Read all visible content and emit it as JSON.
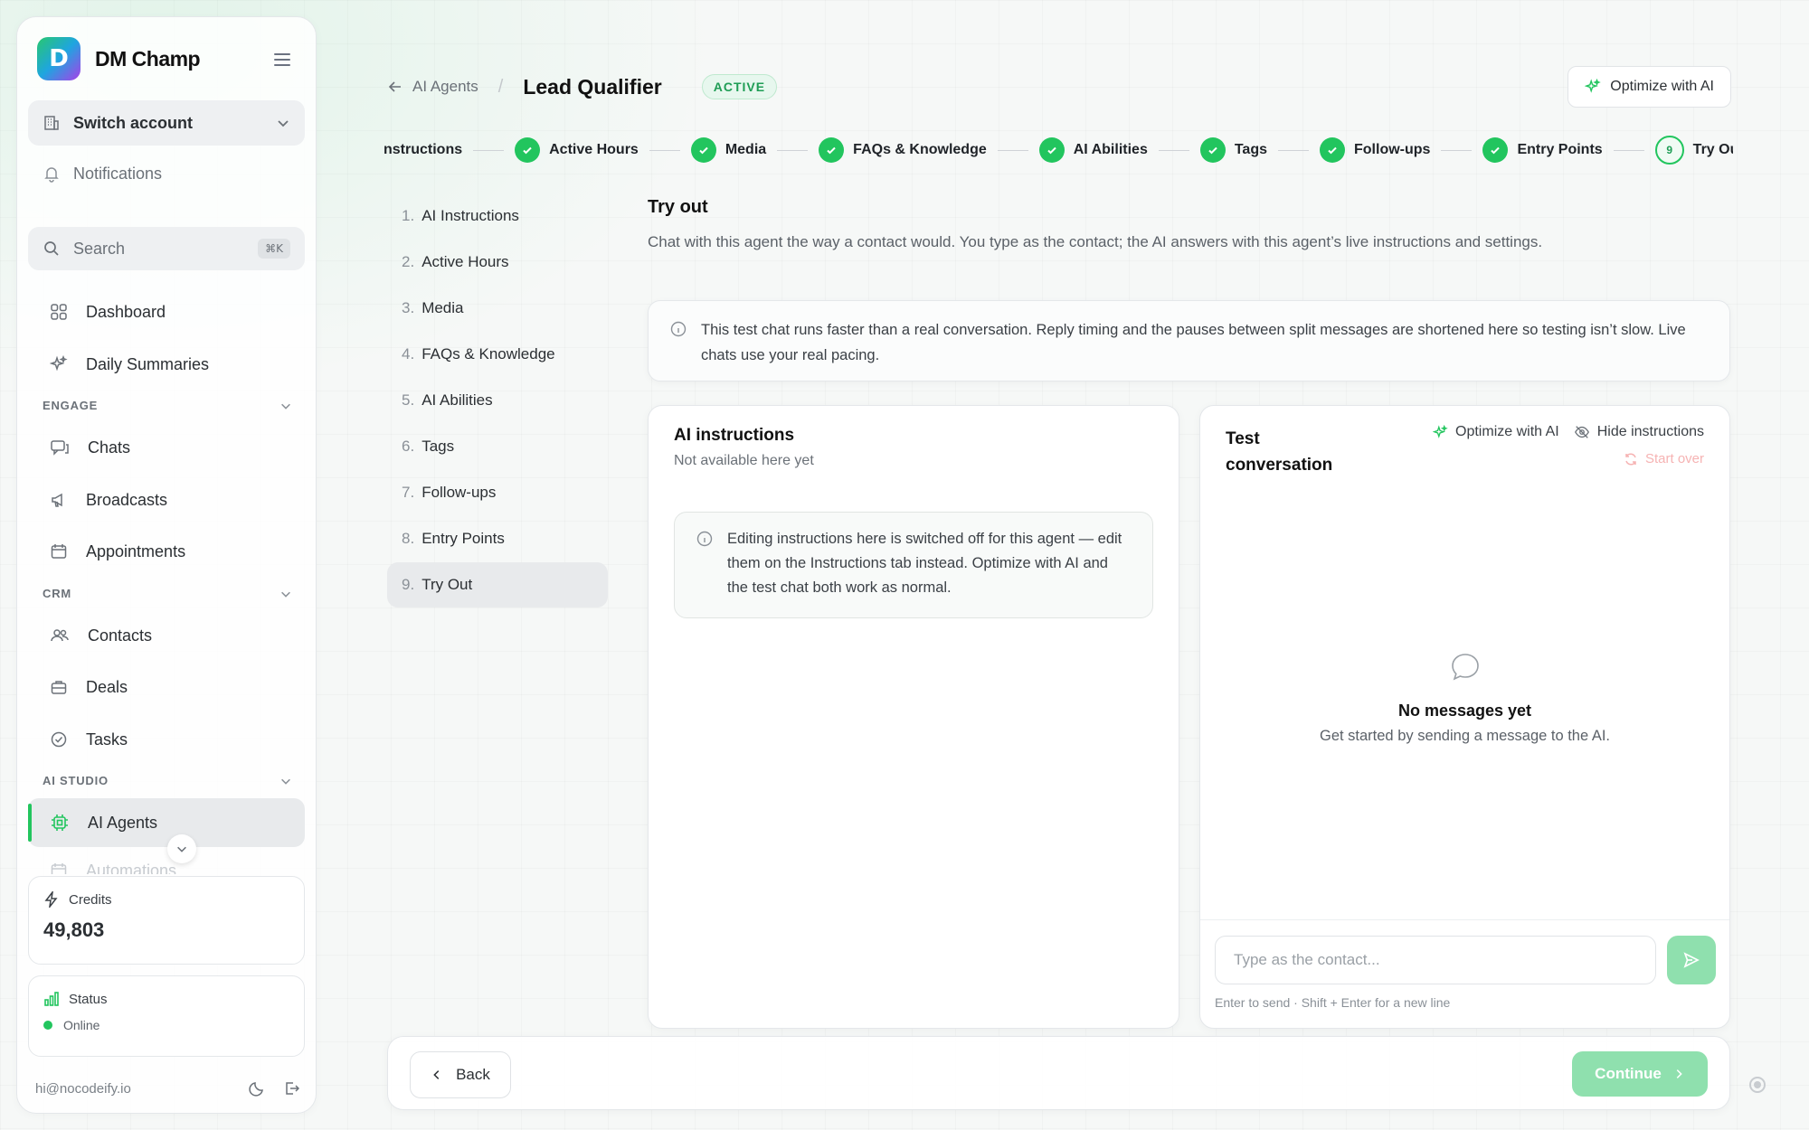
{
  "brand": {
    "name": "DM Champ",
    "logo_letter": "D"
  },
  "sidebar": {
    "switch_account": "Switch account",
    "notifications": "Notifications",
    "search_label": "Search",
    "search_shortcut": "⌘K",
    "top_items": [
      {
        "label": "Dashboard",
        "icon": "grid-icon"
      },
      {
        "label": "Daily Summaries",
        "icon": "sparkles-icon"
      }
    ],
    "sections": [
      {
        "title": "ENGAGE",
        "items": [
          {
            "label": "Chats",
            "icon": "chat-icon"
          },
          {
            "label": "Broadcasts",
            "icon": "megaphone-icon"
          },
          {
            "label": "Appointments",
            "icon": "calendar-icon"
          }
        ]
      },
      {
        "title": "CRM",
        "items": [
          {
            "label": "Contacts",
            "icon": "users-icon"
          },
          {
            "label": "Deals",
            "icon": "briefcase-icon"
          },
          {
            "label": "Tasks",
            "icon": "check-circle-icon"
          }
        ]
      },
      {
        "title": "AI STUDIO",
        "items": [
          {
            "label": "AI Agents",
            "icon": "chip-icon",
            "active": true
          },
          {
            "label": "Automations",
            "icon": "calendar-icon"
          }
        ]
      }
    ],
    "credits": {
      "label": "Credits",
      "value": "49,803"
    },
    "status": {
      "label": "Status",
      "value": "Online"
    },
    "user_email": "hi@nocodeify.io"
  },
  "header": {
    "back_label": "AI Agents",
    "title": "Lead Qualifier",
    "badge": "ACTIVE",
    "optimize_label": "Optimize with AI"
  },
  "stepper": [
    {
      "label": "nstructions",
      "done": true
    },
    {
      "label": "Active Hours",
      "done": true
    },
    {
      "label": "Media",
      "done": true
    },
    {
      "label": "FAQs & Knowledge",
      "done": true
    },
    {
      "label": "AI Abilities",
      "done": true
    },
    {
      "label": "Tags",
      "done": true
    },
    {
      "label": "Follow-ups",
      "done": true
    },
    {
      "label": "Entry Points",
      "done": true
    },
    {
      "label": "Try Out",
      "done": false,
      "number": "9",
      "current": true
    }
  ],
  "steplist": [
    {
      "num": "1.",
      "label": "AI Instructions"
    },
    {
      "num": "2.",
      "label": "Active Hours"
    },
    {
      "num": "3.",
      "label": "Media"
    },
    {
      "num": "4.",
      "label": "FAQs & Knowledge"
    },
    {
      "num": "5.",
      "label": "AI Abilities"
    },
    {
      "num": "6.",
      "label": "Tags"
    },
    {
      "num": "7.",
      "label": "Follow-ups"
    },
    {
      "num": "8.",
      "label": "Entry Points"
    },
    {
      "num": "9.",
      "label": "Try Out",
      "active": true
    }
  ],
  "content": {
    "title": "Try out",
    "description": "Chat with this agent the way a contact would. You type as the contact; the AI answers with this agent’s live instructions and settings.",
    "notice": "This test chat runs faster than a real conversation. Reply timing and the pauses between split messages are shortened here so testing isn’t slow. Live chats use your real pacing."
  },
  "instructions_panel": {
    "title": "AI instructions",
    "subtitle": "Not available here yet",
    "notice": "Editing instructions here is switched off for this agent — edit them on the Instructions tab instead. Optimize with AI and the test chat both work as normal."
  },
  "test_panel": {
    "title": "Test conversation",
    "optimize_label": "Optimize with AI",
    "hide_label": "Hide instructions",
    "start_over_label": "Start over",
    "empty_title": "No messages yet",
    "empty_subtitle": "Get started by sending a message to the AI.",
    "input_placeholder": "Type as the contact...",
    "hint": "Enter to send · Shift + Enter for a new line"
  },
  "footer": {
    "back_label": "Back",
    "continue_label": "Continue"
  },
  "colors": {
    "accent": "#22c55e",
    "accent_light": "#8fe0ae",
    "danger_light": "#f6b3b3"
  }
}
